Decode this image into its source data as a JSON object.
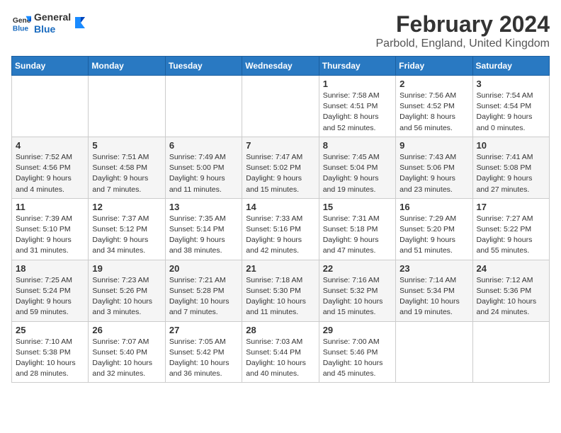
{
  "logo": {
    "line1": "General",
    "line2": "Blue"
  },
  "title": "February 2024",
  "subtitle": "Parbold, England, United Kingdom",
  "days_header": [
    "Sunday",
    "Monday",
    "Tuesday",
    "Wednesday",
    "Thursday",
    "Friday",
    "Saturday"
  ],
  "weeks": [
    [
      {
        "day": "",
        "info": ""
      },
      {
        "day": "",
        "info": ""
      },
      {
        "day": "",
        "info": ""
      },
      {
        "day": "",
        "info": ""
      },
      {
        "day": "1",
        "info": "Sunrise: 7:58 AM\nSunset: 4:51 PM\nDaylight: 8 hours\nand 52 minutes."
      },
      {
        "day": "2",
        "info": "Sunrise: 7:56 AM\nSunset: 4:52 PM\nDaylight: 8 hours\nand 56 minutes."
      },
      {
        "day": "3",
        "info": "Sunrise: 7:54 AM\nSunset: 4:54 PM\nDaylight: 9 hours\nand 0 minutes."
      }
    ],
    [
      {
        "day": "4",
        "info": "Sunrise: 7:52 AM\nSunset: 4:56 PM\nDaylight: 9 hours\nand 4 minutes."
      },
      {
        "day": "5",
        "info": "Sunrise: 7:51 AM\nSunset: 4:58 PM\nDaylight: 9 hours\nand 7 minutes."
      },
      {
        "day": "6",
        "info": "Sunrise: 7:49 AM\nSunset: 5:00 PM\nDaylight: 9 hours\nand 11 minutes."
      },
      {
        "day": "7",
        "info": "Sunrise: 7:47 AM\nSunset: 5:02 PM\nDaylight: 9 hours\nand 15 minutes."
      },
      {
        "day": "8",
        "info": "Sunrise: 7:45 AM\nSunset: 5:04 PM\nDaylight: 9 hours\nand 19 minutes."
      },
      {
        "day": "9",
        "info": "Sunrise: 7:43 AM\nSunset: 5:06 PM\nDaylight: 9 hours\nand 23 minutes."
      },
      {
        "day": "10",
        "info": "Sunrise: 7:41 AM\nSunset: 5:08 PM\nDaylight: 9 hours\nand 27 minutes."
      }
    ],
    [
      {
        "day": "11",
        "info": "Sunrise: 7:39 AM\nSunset: 5:10 PM\nDaylight: 9 hours\nand 31 minutes."
      },
      {
        "day": "12",
        "info": "Sunrise: 7:37 AM\nSunset: 5:12 PM\nDaylight: 9 hours\nand 34 minutes."
      },
      {
        "day": "13",
        "info": "Sunrise: 7:35 AM\nSunset: 5:14 PM\nDaylight: 9 hours\nand 38 minutes."
      },
      {
        "day": "14",
        "info": "Sunrise: 7:33 AM\nSunset: 5:16 PM\nDaylight: 9 hours\nand 42 minutes."
      },
      {
        "day": "15",
        "info": "Sunrise: 7:31 AM\nSunset: 5:18 PM\nDaylight: 9 hours\nand 47 minutes."
      },
      {
        "day": "16",
        "info": "Sunrise: 7:29 AM\nSunset: 5:20 PM\nDaylight: 9 hours\nand 51 minutes."
      },
      {
        "day": "17",
        "info": "Sunrise: 7:27 AM\nSunset: 5:22 PM\nDaylight: 9 hours\nand 55 minutes."
      }
    ],
    [
      {
        "day": "18",
        "info": "Sunrise: 7:25 AM\nSunset: 5:24 PM\nDaylight: 9 hours\nand 59 minutes."
      },
      {
        "day": "19",
        "info": "Sunrise: 7:23 AM\nSunset: 5:26 PM\nDaylight: 10 hours\nand 3 minutes."
      },
      {
        "day": "20",
        "info": "Sunrise: 7:21 AM\nSunset: 5:28 PM\nDaylight: 10 hours\nand 7 minutes."
      },
      {
        "day": "21",
        "info": "Sunrise: 7:18 AM\nSunset: 5:30 PM\nDaylight: 10 hours\nand 11 minutes."
      },
      {
        "day": "22",
        "info": "Sunrise: 7:16 AM\nSunset: 5:32 PM\nDaylight: 10 hours\nand 15 minutes."
      },
      {
        "day": "23",
        "info": "Sunrise: 7:14 AM\nSunset: 5:34 PM\nDaylight: 10 hours\nand 19 minutes."
      },
      {
        "day": "24",
        "info": "Sunrise: 7:12 AM\nSunset: 5:36 PM\nDaylight: 10 hours\nand 24 minutes."
      }
    ],
    [
      {
        "day": "25",
        "info": "Sunrise: 7:10 AM\nSunset: 5:38 PM\nDaylight: 10 hours\nand 28 minutes."
      },
      {
        "day": "26",
        "info": "Sunrise: 7:07 AM\nSunset: 5:40 PM\nDaylight: 10 hours\nand 32 minutes."
      },
      {
        "day": "27",
        "info": "Sunrise: 7:05 AM\nSunset: 5:42 PM\nDaylight: 10 hours\nand 36 minutes."
      },
      {
        "day": "28",
        "info": "Sunrise: 7:03 AM\nSunset: 5:44 PM\nDaylight: 10 hours\nand 40 minutes."
      },
      {
        "day": "29",
        "info": "Sunrise: 7:00 AM\nSunset: 5:46 PM\nDaylight: 10 hours\nand 45 minutes."
      },
      {
        "day": "",
        "info": ""
      },
      {
        "day": "",
        "info": ""
      }
    ]
  ]
}
